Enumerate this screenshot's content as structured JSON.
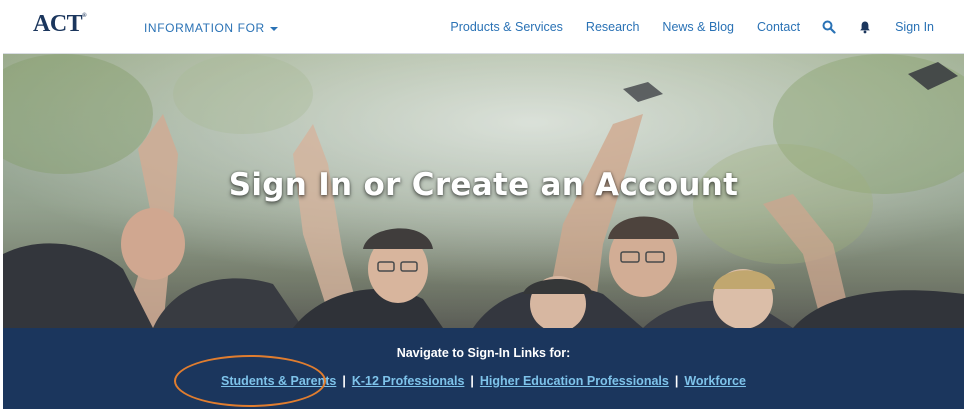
{
  "header": {
    "logo_text": "ACT",
    "logo_mark": "®",
    "info_for_label": "INFORMATION FOR",
    "nav": [
      {
        "label": "Products & Services"
      },
      {
        "label": "Research"
      },
      {
        "label": "News & Blog"
      },
      {
        "label": "Contact"
      }
    ],
    "icons": [
      "search-icon",
      "bell-icon"
    ],
    "sign_in_label": "Sign In"
  },
  "hero": {
    "title": "Sign In or Create an Account"
  },
  "signin_band": {
    "heading": "Navigate to Sign-In Links for:",
    "links": [
      {
        "label": "Students & Parents"
      },
      {
        "label": "K-12 Professionals"
      },
      {
        "label": "Higher Education Professionals"
      },
      {
        "label": "Workforce"
      }
    ],
    "separator": "|"
  },
  "colors": {
    "brand_navy": "#1b365d",
    "link_blue": "#2a72b5",
    "band_link": "#7ec3ea",
    "annotation_orange": "#e07d2f"
  }
}
